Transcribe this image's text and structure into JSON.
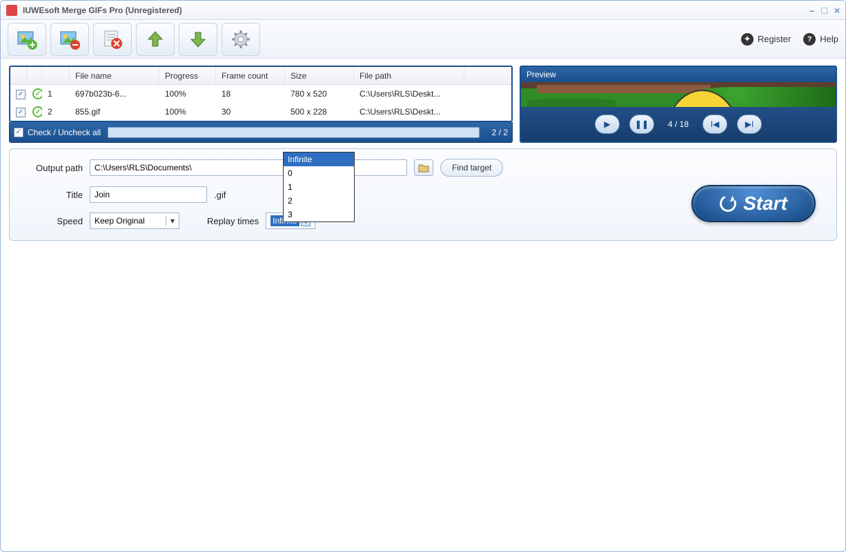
{
  "window": {
    "title": "IUWEsoft Merge GIFs Pro (Unregistered)"
  },
  "toolbar": {
    "register": "Register",
    "help": "Help"
  },
  "table": {
    "headers": {
      "filename": "File name",
      "progress": "Progress",
      "framecount": "Frame count",
      "size": "Size",
      "filepath": "File path"
    },
    "rows": [
      {
        "idx": "1",
        "name": "697b023b-6...",
        "progress": "100%",
        "frames": "18",
        "size": "780 x 520",
        "path": "C:\\Users\\RLS\\Deskt..."
      },
      {
        "idx": "2",
        "name": "855.gif",
        "progress": "100%",
        "frames": "30",
        "size": "500 x 228",
        "path": "C:\\Users\\RLS\\Deskt..."
      }
    ]
  },
  "checkall": {
    "label": "Check / Uncheck all",
    "count": "2 / 2"
  },
  "preview": {
    "label": "Preview",
    "framepos": "4 / 18"
  },
  "form": {
    "outputpath_label": "Output path",
    "outputpath_value": "C:\\Users\\RLS\\Documents\\",
    "find_target": "Find target",
    "title_label": "Title",
    "title_value": "Join",
    "title_suffix": ".gif",
    "speed_label": "Speed",
    "speed_value": "Keep Original",
    "replay_label": "Replay times",
    "replay_value": "Infinite",
    "replay_options": [
      "Infinite",
      "0",
      "1",
      "2",
      "3"
    ],
    "start": "Start"
  }
}
